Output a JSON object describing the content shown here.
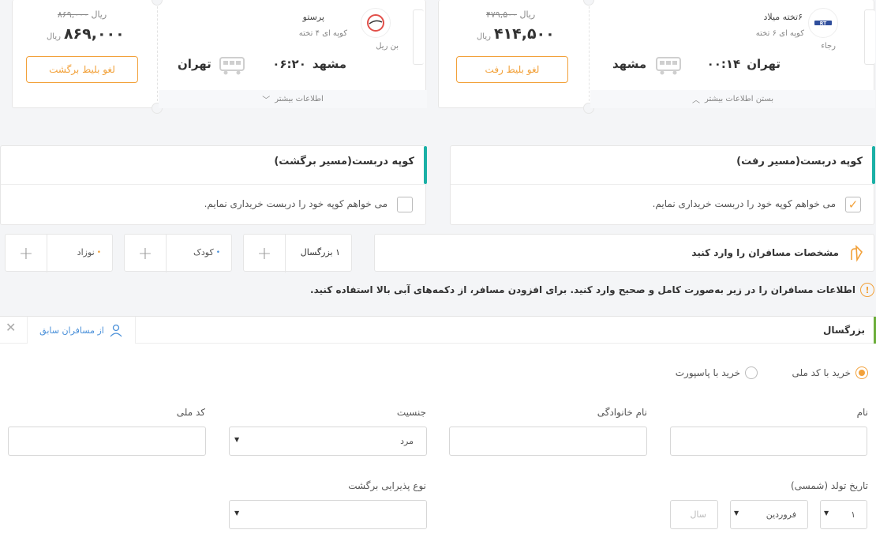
{
  "ticket_outbound": {
    "operator_name": "رجاء",
    "train_name": "۶تخته میلاد",
    "coupe_info": "کوپه ای ۶ تخته",
    "old_price": "۴۷۹,۵۰۰",
    "old_currency": "ریال",
    "price": "۴۱۴,۵۰۰",
    "currency": "ریال",
    "from_city": "تهران",
    "time": "۰۰:۱۴",
    "to_city": "مشهد",
    "cancel_label": "لغو بلیط رفت",
    "info_toggle": "بستن اطلاعات بیشتر"
  },
  "ticket_return": {
    "operator_name": "بن ریل",
    "train_name": "پرستو",
    "coupe_info": "کوپه ای ۴ تخته",
    "old_price": "۸۶۹,۰۰۰",
    "old_currency": "ریال",
    "price": "۸۶۹,۰۰۰",
    "currency": "ریال",
    "from_city": "مشهد",
    "time": "۰۶:۲۰",
    "to_city": "تهران",
    "cancel_label": "لغو بلیط برگشت",
    "info_toggle": "اطلاعات بیشتر"
  },
  "coupe_outbound": {
    "title": "کوپه دربست(مسیر رفت)",
    "checkbox_label": "می خواهم کوپه خود را دربست خریداری نمایم."
  },
  "coupe_return": {
    "title": "کوپه دربست(مسیر برگشت)",
    "checkbox_label": "می خواهم کوپه خود را دربست خریداری نمایم."
  },
  "passengers_bar": {
    "title": "مشخصات مسافران را وارد کنید",
    "adult_label": "۱ بزرگسال",
    "child_label": "کودک",
    "infant_label": "نوزاد"
  },
  "notice": "اطلاعات مسافران را در زیر به‌صورت کامل و صحیح وارد کنید. برای افزودن مسافر، از دکمه‌های آبی بالا استفاده کنید.",
  "passenger_form": {
    "header": "بزرگسال",
    "previous_passengers": "از مسافران سابق",
    "radio_national": "خرید با کد ملی",
    "radio_passport": "خرید با پاسپورت",
    "first_name_label": "نام",
    "last_name_label": "نام خانوادگی",
    "gender_label": "جنسیت",
    "gender_value": "مرد",
    "national_code_label": "کد ملی",
    "birth_label": "تاریخ تولد (شمسی)",
    "birth_day": "۱",
    "birth_month": "فروردین",
    "birth_year_placeholder": "سال",
    "return_service_label": "نوع پذیرایی برگشت"
  },
  "colors": {
    "accent_orange": "#f2a13a",
    "teal": "#1bb0a6",
    "green": "#6cae3a"
  }
}
